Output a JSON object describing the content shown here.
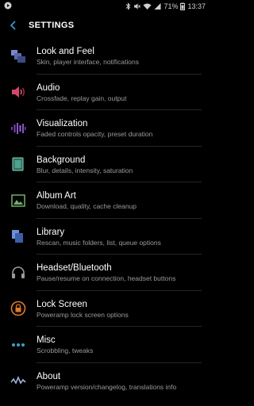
{
  "status_bar": {
    "battery": "71%",
    "time": "13:37"
  },
  "app_bar": {
    "title": "SETTINGS"
  },
  "items": [
    {
      "label": "Look and Feel",
      "sub": "Skin, player interface, notifications",
      "icon": "look-and-feel-icon",
      "color": "#5a6aa8"
    },
    {
      "label": "Audio",
      "sub": "Crossfade, replay gain, output",
      "icon": "speaker-icon",
      "color": "#d6456a"
    },
    {
      "label": "Visualization",
      "sub": "Faded controls opacity, preset duration",
      "icon": "waveform-icon",
      "color": "#8b54c8"
    },
    {
      "label": "Background",
      "sub": "Blur, details, intensity, saturation",
      "icon": "background-icon",
      "color": "#3a8f7a"
    },
    {
      "label": "Album Art",
      "sub": "Download, quality, cache cleanup",
      "icon": "image-icon",
      "color": "#5fa05a"
    },
    {
      "label": "Library",
      "sub": "Rescan, music folders, list, queue options",
      "icon": "library-icon",
      "color": "#4a72c0"
    },
    {
      "label": "Headset/Bluetooth",
      "sub": "Pause/resume on connection, headset buttons",
      "icon": "headset-icon",
      "color": "#8a8a8a"
    },
    {
      "label": "Lock Screen",
      "sub": "Poweramp lock screen options",
      "icon": "lock-icon",
      "color": "#e07a2a"
    },
    {
      "label": "Misc",
      "sub": "Scrobbling, tweaks",
      "icon": "dots-icon",
      "color": "#3aa0c8"
    },
    {
      "label": "About",
      "sub": "Poweramp version/changelog, translations info",
      "icon": "about-wave-icon",
      "color": "#a0b0d8"
    }
  ]
}
